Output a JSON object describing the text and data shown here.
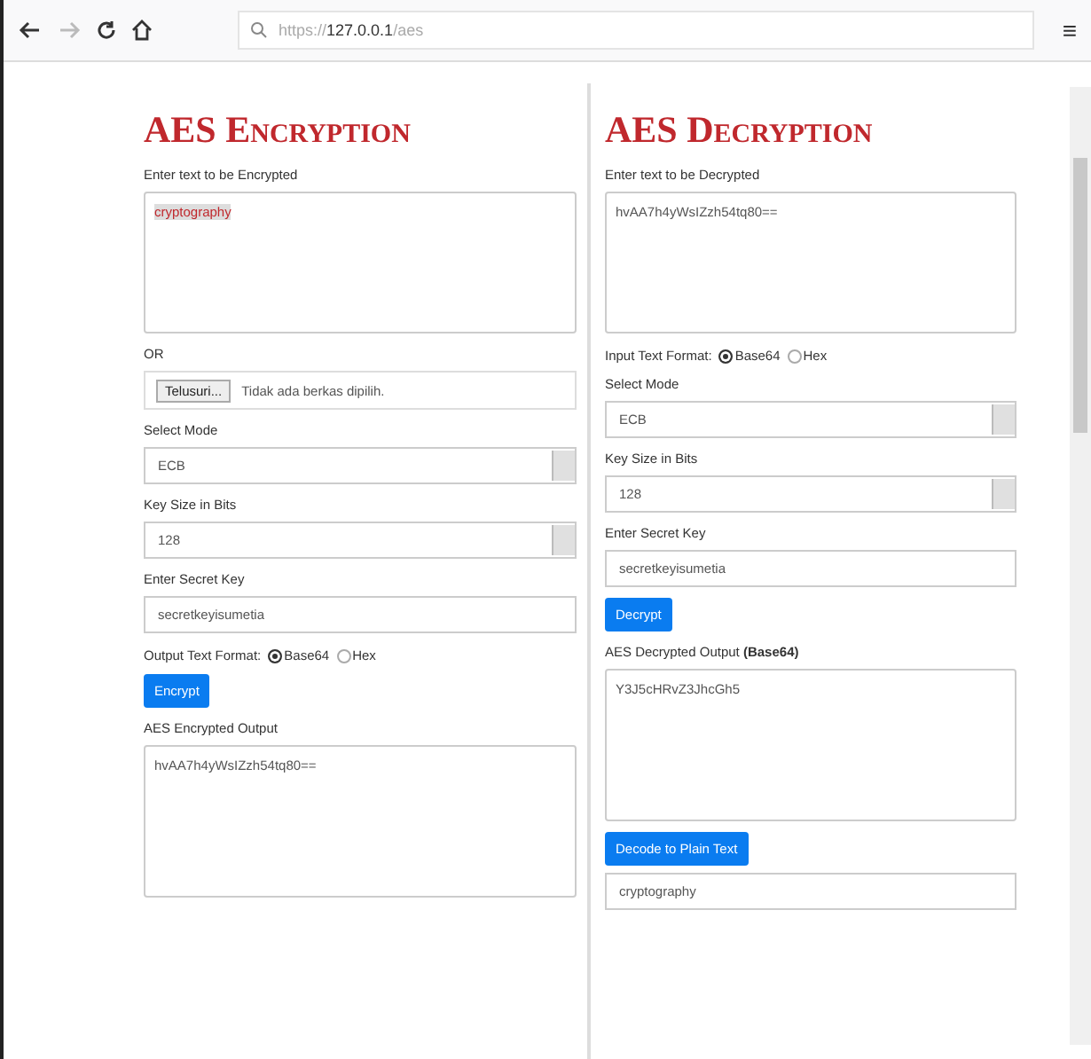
{
  "browser": {
    "url_prefix": "https://",
    "url_host": "127.0.0.1",
    "url_path": "/aes",
    "menu_glyph": "≡"
  },
  "encryption": {
    "title": "AES Encryption",
    "input_label": "Enter text to be Encrypted",
    "input_value": "cryptography",
    "or_label": "OR",
    "file_button": "Telusuri...",
    "file_status": "Tidak ada berkas dipilih.",
    "mode_label": "Select Mode",
    "mode_value": "ECB",
    "keysize_label": "Key Size in Bits",
    "keysize_value": "128",
    "key_label": "Enter Secret Key",
    "key_value": "secretkeyisumetia",
    "format_label": "Output Text Format:",
    "formats": [
      {
        "label": "Base64",
        "selected": true
      },
      {
        "label": "Hex",
        "selected": false
      }
    ],
    "button": "Encrypt",
    "output_label": "AES Encrypted Output",
    "output_value": "hvAA7h4yWsIZzh54tq80=="
  },
  "decryption": {
    "title": "AES Decryption",
    "input_label": "Enter text to be Decrypted",
    "input_value": "hvAA7h4yWsIZzh54tq80==",
    "format_label": "Input Text Format:",
    "formats": [
      {
        "label": "Base64",
        "selected": true
      },
      {
        "label": "Hex",
        "selected": false
      }
    ],
    "mode_label": "Select Mode",
    "mode_value": "ECB",
    "keysize_label": "Key Size in Bits",
    "keysize_value": "128",
    "key_label": "Enter Secret Key",
    "key_value": "secretkeyisumetia",
    "button": "Decrypt",
    "output_label": "AES Decrypted Output **(Base64)**",
    "output_value": "Y3J5cHRvZ3JhcGh5",
    "decode_button": "Decode to Plain Text",
    "plain_value": "cryptography"
  }
}
